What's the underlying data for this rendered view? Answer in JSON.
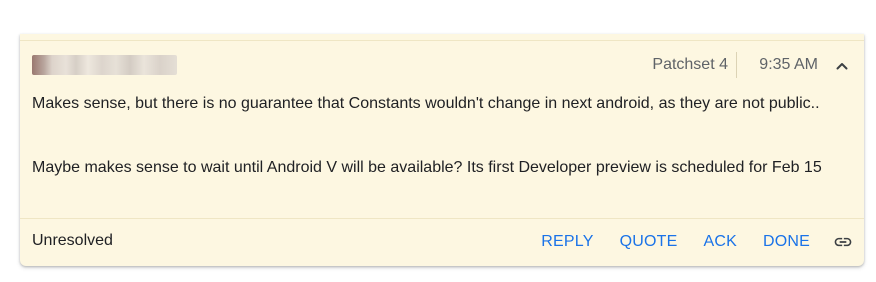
{
  "comment": {
    "patchset": "Patchset 4",
    "time": "9:35 AM",
    "messages": [
      "Makes sense, but there is no guarantee that Constants wouldn't change in next android, as they are not public..",
      "Maybe makes sense to wait until Android V will be available? Its first Developer preview is scheduled for Feb 15"
    ],
    "status": "Unresolved",
    "actions": {
      "reply": "REPLY",
      "quote": "QUOTE",
      "ack": "ACK",
      "done": "DONE"
    }
  },
  "icons": {
    "collapse": "chevron-up-icon",
    "link": "link-icon"
  },
  "colors": {
    "card_background": "#fdf7e1",
    "action_blue": "#1a73e8",
    "meta_gray": "#5f6368",
    "text": "#202124"
  }
}
